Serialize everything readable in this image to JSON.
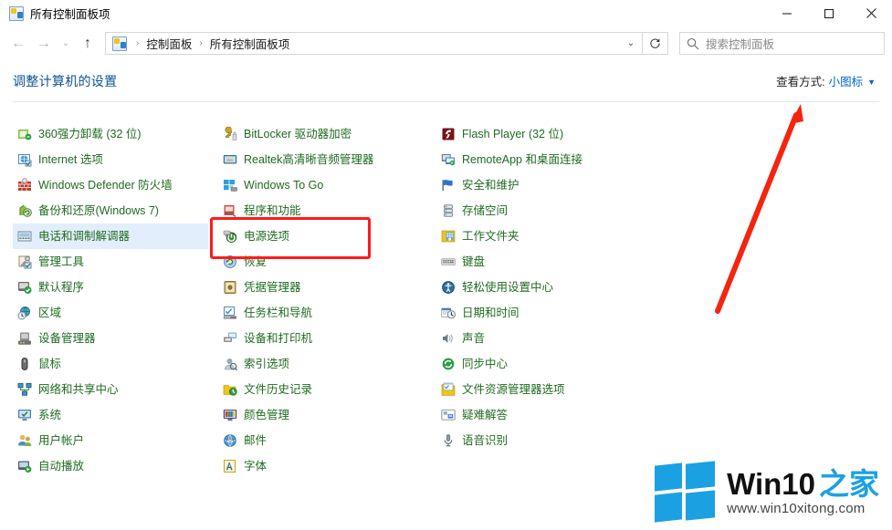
{
  "window": {
    "title": "所有控制面板项",
    "title_icon": "control-panel-icon",
    "minimize_label": "最小化",
    "maximize_label": "最大化",
    "close_label": "关闭"
  },
  "nav": {
    "back_icon": "back-arrow-icon",
    "forward_icon": "forward-arrow-icon",
    "recent_icon": "chevron-down-icon",
    "up_icon": "up-arrow-icon",
    "refresh_icon": "refresh-icon",
    "address_dropdown_icon": "chevron-down-icon",
    "breadcrumbs": [
      "控制面板",
      "所有控制面板项"
    ],
    "separator": "›"
  },
  "search": {
    "icon": "search-icon",
    "placeholder": "搜索控制面板",
    "value": ""
  },
  "header": {
    "page_title": "调整计算机的设置",
    "view_by_label": "查看方式:",
    "view_by_value": "小图标",
    "view_by_caret": "▼",
    "title_color": "#0b5394",
    "accent_color": "#0066cc"
  },
  "items": {
    "column1": [
      {
        "label": "360强力卸载 (32 位)",
        "icon": "360-uninstall-icon",
        "hover": false
      },
      {
        "label": "Internet 选项",
        "icon": "internet-options-icon",
        "hover": false
      },
      {
        "label": "Windows Defender 防火墙",
        "icon": "firewall-icon",
        "hover": false
      },
      {
        "label": "备份和还原(Windows 7)",
        "icon": "backup-restore-icon",
        "hover": false
      },
      {
        "label": "电话和调制解调器",
        "icon": "phone-modem-icon",
        "hover": true
      },
      {
        "label": "管理工具",
        "icon": "admin-tools-icon",
        "hover": false
      },
      {
        "label": "默认程序",
        "icon": "default-programs-icon",
        "hover": false
      },
      {
        "label": "区域",
        "icon": "region-icon",
        "hover": false
      },
      {
        "label": "设备管理器",
        "icon": "device-manager-icon",
        "hover": false
      },
      {
        "label": "鼠标",
        "icon": "mouse-icon",
        "hover": false
      },
      {
        "label": "网络和共享中心",
        "icon": "network-sharing-icon",
        "hover": false
      },
      {
        "label": "系统",
        "icon": "system-icon",
        "hover": false
      },
      {
        "label": "用户帐户",
        "icon": "user-accounts-icon",
        "hover": false
      },
      {
        "label": "自动播放",
        "icon": "autoplay-icon",
        "hover": false
      }
    ],
    "column2": [
      {
        "label": "BitLocker 驱动器加密",
        "icon": "bitlocker-icon",
        "hover": false
      },
      {
        "label": "Realtek高清晰音频管理器",
        "icon": "realtek-audio-icon",
        "hover": false
      },
      {
        "label": "Windows To Go",
        "icon": "windows-to-go-icon",
        "hover": false
      },
      {
        "label": "程序和功能",
        "icon": "programs-features-icon",
        "hover": false
      },
      {
        "label": "电源选项",
        "icon": "power-options-icon",
        "hover": false
      },
      {
        "label": "恢复",
        "icon": "recovery-icon",
        "hover": false
      },
      {
        "label": "凭据管理器",
        "icon": "credential-manager-icon",
        "hover": false
      },
      {
        "label": "任务栏和导航",
        "icon": "taskbar-navigation-icon",
        "hover": false
      },
      {
        "label": "设备和打印机",
        "icon": "devices-printers-icon",
        "hover": false
      },
      {
        "label": "索引选项",
        "icon": "indexing-options-icon",
        "hover": false
      },
      {
        "label": "文件历史记录",
        "icon": "file-history-icon",
        "hover": false
      },
      {
        "label": "颜色管理",
        "icon": "color-management-icon",
        "hover": false
      },
      {
        "label": "邮件",
        "icon": "mail-icon",
        "hover": false
      },
      {
        "label": "字体",
        "icon": "fonts-icon",
        "hover": false
      }
    ],
    "column3": [
      {
        "label": "Flash Player (32 位)",
        "icon": "flash-player-icon",
        "hover": false
      },
      {
        "label": "RemoteApp 和桌面连接",
        "icon": "remoteapp-icon",
        "hover": false
      },
      {
        "label": "安全和维护",
        "icon": "security-maintenance-icon",
        "hover": false
      },
      {
        "label": "存储空间",
        "icon": "storage-spaces-icon",
        "hover": false
      },
      {
        "label": "工作文件夹",
        "icon": "work-folders-icon",
        "hover": false
      },
      {
        "label": "键盘",
        "icon": "keyboard-icon",
        "hover": false
      },
      {
        "label": "轻松使用设置中心",
        "icon": "ease-of-access-icon",
        "hover": false
      },
      {
        "label": "日期和时间",
        "icon": "date-time-icon",
        "hover": false
      },
      {
        "label": "声音",
        "icon": "sound-icon",
        "hover": false
      },
      {
        "label": "同步中心",
        "icon": "sync-center-icon",
        "hover": false
      },
      {
        "label": "文件资源管理器选项",
        "icon": "file-explorer-options-icon",
        "hover": false
      },
      {
        "label": "疑难解答",
        "icon": "troubleshooting-icon",
        "hover": false
      },
      {
        "label": "语音识别",
        "icon": "speech-recognition-icon",
        "hover": false
      }
    ]
  },
  "annotations": {
    "highlight_box": {
      "name": "power-options-highlight-box",
      "color": "#ff1a1a",
      "targets": "电源选项"
    },
    "arrow": {
      "name": "view-by-pointer-arrow",
      "color": "#ff1a1a",
      "points_to": "小图标"
    }
  },
  "watermark": {
    "logo_icon": "windows-logo-icon",
    "brand_black": "Win10",
    "brand_blue": "之家",
    "url": "www.win10xitong.com",
    "brand_color": "#1ba1e2"
  }
}
